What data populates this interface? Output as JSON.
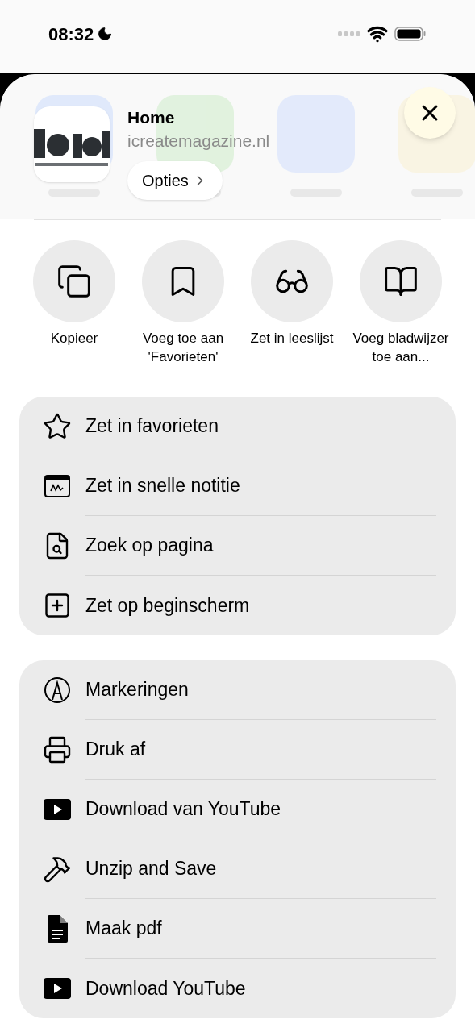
{
  "status_bar": {
    "time": "08:32"
  },
  "header": {
    "title": "Home",
    "subtitle": "icreatemagazine.nl",
    "options_button": "Opties"
  },
  "quick_actions": [
    {
      "kind": "copy",
      "label": "Kopieer"
    },
    {
      "kind": "bookmark",
      "label": "Voeg toe aan 'Favorieten'"
    },
    {
      "kind": "glasses",
      "label": "Zet in leeslijst"
    },
    {
      "kind": "book",
      "label": "Voeg bladwijzer toe aan..."
    }
  ],
  "groups": [
    {
      "items": [
        {
          "kind": "star",
          "label": "Zet in favorieten"
        },
        {
          "kind": "note",
          "label": "Zet in snelle notitie"
        },
        {
          "kind": "search-page",
          "label": "Zoek op pagina"
        },
        {
          "kind": "plus-square",
          "label": "Zet op beginscherm"
        }
      ]
    },
    {
      "items": [
        {
          "kind": "markup",
          "label": "Markeringen"
        },
        {
          "kind": "printer",
          "label": "Druk af"
        },
        {
          "kind": "play",
          "label": "Download van YouTube"
        },
        {
          "kind": "hammer",
          "label": "Unzip and Save"
        },
        {
          "kind": "doc",
          "label": "Maak pdf"
        },
        {
          "kind": "play",
          "label": "Download YouTube"
        }
      ]
    }
  ]
}
